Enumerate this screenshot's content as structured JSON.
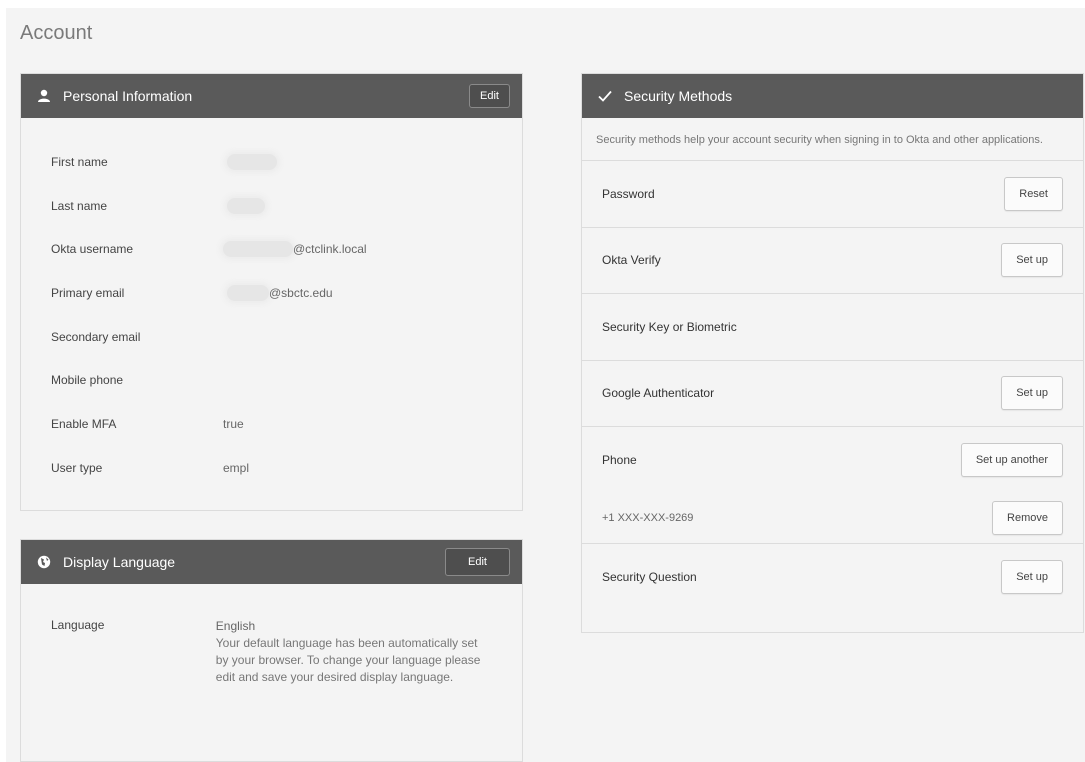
{
  "page": {
    "title": "Account"
  },
  "personal": {
    "title": "Personal Information",
    "icon": "person-icon",
    "edit_label": "Edit",
    "rows": [
      {
        "label": "First name",
        "value": ""
      },
      {
        "label": "Last name",
        "value": ""
      },
      {
        "label": "Okta username",
        "value": "@ctclink.local"
      },
      {
        "label": "Primary email",
        "value": "@sbctc.edu"
      },
      {
        "label": "Secondary email",
        "value": ""
      },
      {
        "label": "Mobile phone",
        "value": ""
      },
      {
        "label": "Enable MFA",
        "value": "true"
      },
      {
        "label": "User type",
        "value": "empl"
      }
    ]
  },
  "language": {
    "title": "Display Language",
    "icon": "globe-icon",
    "edit_label": "Edit",
    "label": "Language",
    "value": "English",
    "note": "Your default language has been automatically set by your browser. To change your language please edit and save your desired display language."
  },
  "security": {
    "title": "Security Methods",
    "icon": "checkmark-icon",
    "description": "Security methods help your account security when signing in to Okta and other applications.",
    "password": {
      "label": "Password",
      "button": "Reset"
    },
    "okta_verify": {
      "label": "Okta Verify",
      "button": "Set up"
    },
    "security_key": {
      "label": "Security Key or Biometric"
    },
    "google_auth": {
      "label": "Google Authenticator",
      "button": "Set up"
    },
    "phone": {
      "label": "Phone",
      "button": "Set up another",
      "number": "+1 XXX-XXX-9269",
      "remove": "Remove"
    },
    "question": {
      "label": "Security Question",
      "button": "Set up"
    }
  },
  "colors": {
    "header_bg": "#5a5a5a",
    "page_bg": "#f4f4f4"
  }
}
